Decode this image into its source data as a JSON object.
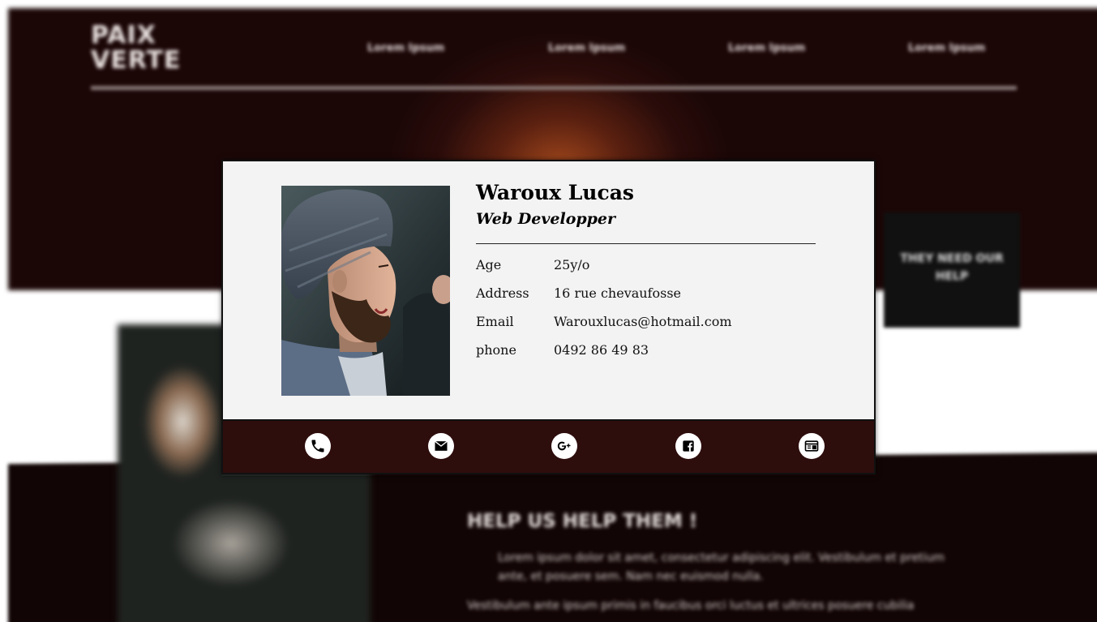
{
  "background": {
    "logo": "PAIX\nVERTE",
    "nav": [
      "Lorem Ipsum",
      "Lorem Ipsum",
      "Lorem Ipsum",
      "Lorem Ipsum"
    ],
    "side_card_text": "THEY NEED OUR HELP",
    "section_heading": "HELP US HELP THEM !",
    "paragraph_1": "Lorem ipsum dolor sit amet, consectetur adipiscing elit. Vestibulum et pretium ante, et posuere sem. Nam nec euismod nulla.",
    "paragraph_2": "Vestibulum ante ipsum primis in faucibus orci luctus et ultrices posuere cubilia"
  },
  "profile": {
    "name": "Waroux Lucas",
    "title": "Web Developper",
    "fields": [
      {
        "label": "Age",
        "value": "25y/o"
      },
      {
        "label": "Address",
        "value": "16 rue chevaufosse"
      },
      {
        "label": "Email",
        "value": "Warouxlucas@hotmail.com"
      },
      {
        "label": "phone",
        "value": "0492 86 49 83"
      }
    ]
  },
  "contact_icons": [
    "phone-icon",
    "mail-icon",
    "google-plus-icon",
    "facebook-icon",
    "portfolio-icon"
  ],
  "colors": {
    "card_background": "#f3f3f3",
    "footer_background": "#2e0d0d",
    "hero_dark": "#1c0707"
  }
}
